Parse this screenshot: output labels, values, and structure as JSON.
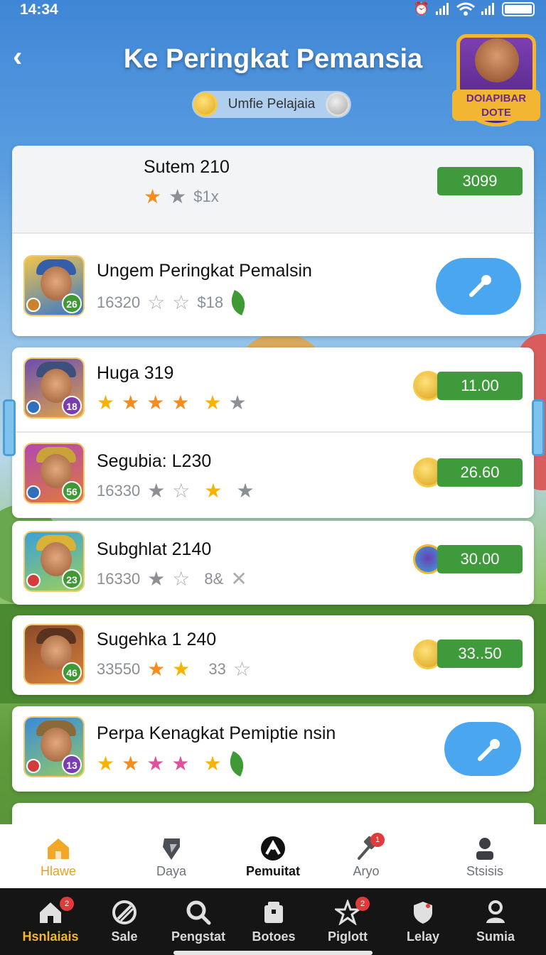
{
  "status_bar": {
    "time": "14:34"
  },
  "header": {
    "title": "Ke Peringkat Pemansia",
    "pill_label": "Umfie Pelajaia",
    "badge_text": "DOIAPIBAR DOTE"
  },
  "colors": {
    "score_green": "#3e9a3a",
    "button_blue": "#4aa7ef",
    "accent_gold": "#f4b400"
  },
  "rows": [
    {
      "name": "Sutem 210",
      "meta": "$1x",
      "score": "3099",
      "level": "",
      "action": "score"
    },
    {
      "name": "Ungem Peringkat Pemalsin",
      "meta": "16320",
      "extra": "$18",
      "level": "26",
      "action": "tool-button"
    },
    {
      "name": "Huga 319",
      "meta": "",
      "score": "11.00",
      "level": "18",
      "action": "coin-score"
    },
    {
      "name": "Segubia: L230",
      "meta": "16330",
      "score": "26.60",
      "level": "56",
      "action": "coin-score"
    },
    {
      "name": "Subghlat 2140",
      "meta": "16330",
      "extra": "8&",
      "score": "30.00",
      "level": "23",
      "action": "gem-score"
    },
    {
      "name": "Sugehka 1 240",
      "meta": "33550",
      "extra": "33",
      "score": "33..50",
      "level": "46",
      "action": "coin-score"
    },
    {
      "name": "Perpa Kenagkat Pemiptie nsin",
      "meta": "",
      "level": "13",
      "action": "tool-button"
    }
  ],
  "tabs": [
    {
      "label": "Hlawe",
      "icon": "home-icon"
    },
    {
      "label": "Daya",
      "icon": "gem-icon"
    },
    {
      "label": "Pemuitat",
      "icon": "ranking-icon"
    },
    {
      "label": "Aryo",
      "icon": "hammer-icon",
      "badge": "1"
    },
    {
      "label": "Stsisis",
      "icon": "profile-icon"
    }
  ],
  "nav": [
    {
      "label": "Hsnlaiais",
      "icon": "home-icon",
      "badge": "2"
    },
    {
      "label": "Sale",
      "icon": "sale-icon"
    },
    {
      "label": "Pengstat",
      "icon": "search-icon"
    },
    {
      "label": "Botoes",
      "icon": "box-icon"
    },
    {
      "label": "Piglott",
      "icon": "star-icon",
      "badge": "2"
    },
    {
      "label": "Lelay",
      "icon": "shield-icon"
    },
    {
      "label": "Sumia",
      "icon": "user-icon"
    }
  ]
}
